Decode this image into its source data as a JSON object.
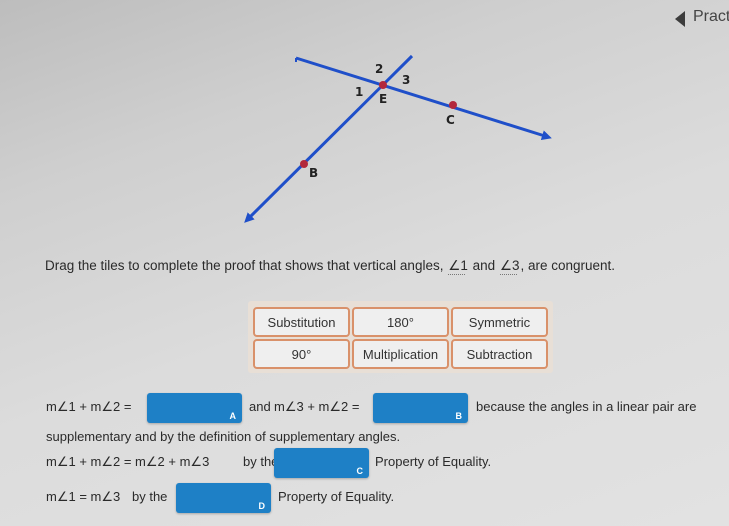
{
  "header": {
    "title": "Practi",
    "back_icon": "back-triangle-icon"
  },
  "diagram": {
    "line_color": "#1f4fc9",
    "point_color": "#b3283c",
    "points": [
      "E",
      "C",
      "B"
    ],
    "angle_labels": [
      "1",
      "2",
      "3"
    ]
  },
  "instruction": {
    "part1": "Drag the tiles to complete the proof that shows that vertical angles, ",
    "angle_a": "∠1",
    "part2": " and ",
    "angle_b": "∠3",
    "part3": ", are congruent."
  },
  "tiles": [
    {
      "label": "Substitution"
    },
    {
      "label": "180°"
    },
    {
      "label": "Symmetric"
    },
    {
      "label": "90°"
    },
    {
      "label": "Multiplication"
    },
    {
      "label": "Subtraction"
    }
  ],
  "proof": {
    "line1": {
      "expr1": "m∠1 + m∠2 =",
      "and": "and",
      "expr2": "m∠3 + m∠2 =",
      "tail": "because the angles in a linear pair are"
    },
    "line2": {
      "text": "supplementary and by the definition of supplementary angles."
    },
    "line3": {
      "expr": "m∠1 + m∠2 = m∠2 + m∠3",
      "by_the": "by the",
      "tail": "Property of Equality."
    },
    "line4": {
      "expr": "m∠1 = m∠3",
      "by_the": "by the",
      "tail": "Property of Equality."
    },
    "drop_zones": [
      {
        "letter": "A",
        "value": ""
      },
      {
        "letter": "B",
        "value": ""
      },
      {
        "letter": "C",
        "value": ""
      },
      {
        "letter": "D",
        "value": ""
      }
    ],
    "drop_color": "#1e80c6"
  }
}
